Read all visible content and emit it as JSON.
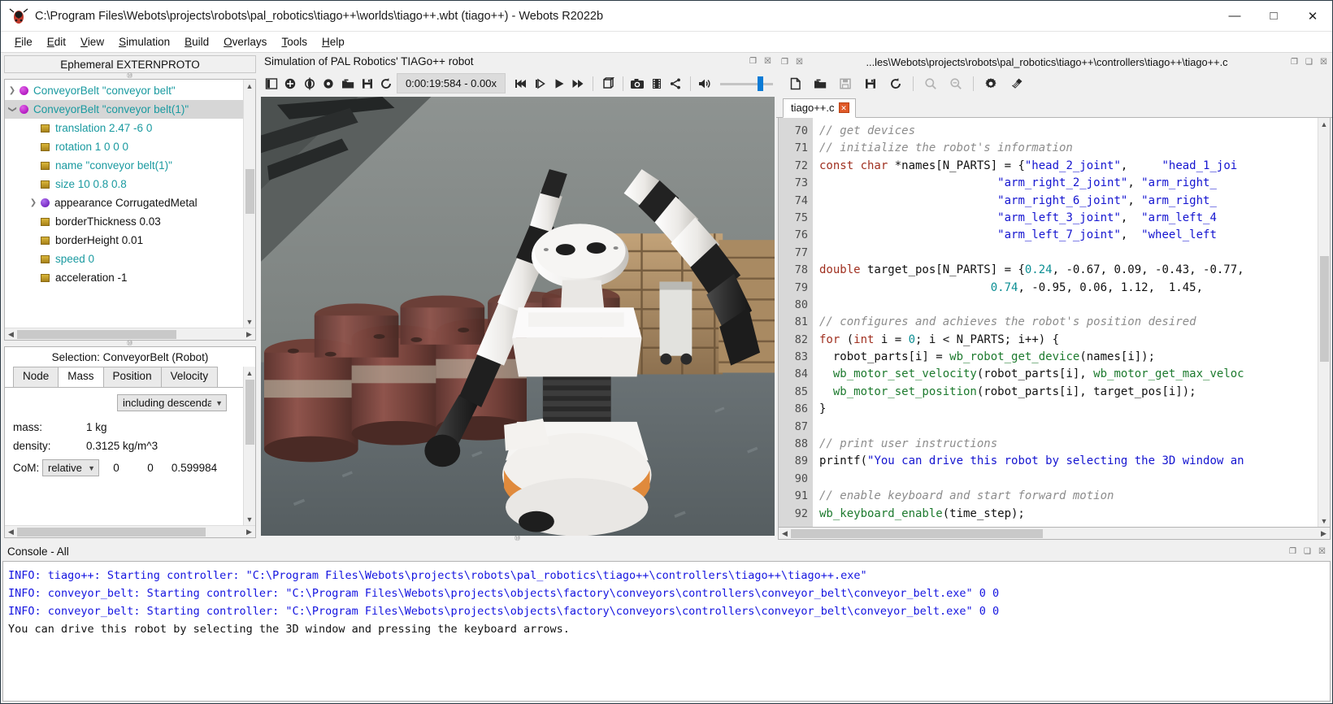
{
  "window": {
    "title": "C:\\Program Files\\Webots\\projects\\robots\\pal_robotics\\tiago++\\worlds\\tiago++.wbt (tiago++) - Webots R2022b",
    "minimize_label": "—",
    "maximize_label": "□",
    "close_label": "✕"
  },
  "menubar": [
    {
      "label": "File",
      "mnemonic": "F"
    },
    {
      "label": "Edit",
      "mnemonic": "E"
    },
    {
      "label": "View",
      "mnemonic": "V"
    },
    {
      "label": "Simulation",
      "mnemonic": "S"
    },
    {
      "label": "Build",
      "mnemonic": "B"
    },
    {
      "label": "Overlays",
      "mnemonic": "O"
    },
    {
      "label": "Tools",
      "mnemonic": "T"
    },
    {
      "label": "Help",
      "mnemonic": "H"
    }
  ],
  "scene_tree": {
    "header": "Ephemeral EXTERNPROTO",
    "items": [
      {
        "label": "ConveyorBelt \"conveyor belt\"",
        "kind": "node",
        "arrow": "collapsed",
        "indent": 0,
        "selected": false,
        "color": "teal"
      },
      {
        "label": "ConveyorBelt \"conveyor belt(1)\"",
        "kind": "node",
        "arrow": "expanded",
        "indent": 0,
        "selected": true,
        "color": "teal"
      },
      {
        "label": "translation 2.47 -6 0",
        "kind": "field",
        "arrow": "none",
        "indent": 1,
        "selected": false,
        "color": "teal"
      },
      {
        "label": "rotation 1 0 0 0",
        "kind": "field",
        "arrow": "none",
        "indent": 1,
        "selected": false,
        "color": "teal"
      },
      {
        "label": "name \"conveyor belt(1)\"",
        "kind": "field",
        "arrow": "none",
        "indent": 1,
        "selected": false,
        "color": "teal"
      },
      {
        "label": "size 10 0.8 0.8",
        "kind": "field",
        "arrow": "none",
        "indent": 1,
        "selected": false,
        "color": "teal"
      },
      {
        "label": "appearance CorrugatedMetal",
        "kind": "nodeblue",
        "arrow": "collapsed",
        "indent": 1,
        "selected": false,
        "color": "black"
      },
      {
        "label": "borderThickness 0.03",
        "kind": "field",
        "arrow": "none",
        "indent": 1,
        "selected": false,
        "color": "black"
      },
      {
        "label": "borderHeight 0.01",
        "kind": "field",
        "arrow": "none",
        "indent": 1,
        "selected": false,
        "color": "black"
      },
      {
        "label": "speed 0",
        "kind": "field",
        "arrow": "none",
        "indent": 1,
        "selected": false,
        "color": "teal"
      },
      {
        "label": "acceleration -1",
        "kind": "field",
        "arrow": "none",
        "indent": 1,
        "selected": false,
        "color": "black"
      }
    ]
  },
  "selection": {
    "title": "Selection: ConveyorBelt (Robot)",
    "tabs": [
      {
        "label": "Node",
        "active": false
      },
      {
        "label": "Mass",
        "active": true
      },
      {
        "label": "Position",
        "active": false
      },
      {
        "label": "Velocity",
        "active": false
      }
    ],
    "scope_select": "including descenda",
    "mass_key": "mass:",
    "mass_value": "1 kg",
    "density_key": "density:",
    "density_value": "0.3125 kg/m^3",
    "com_key": "CoM:",
    "com_frame": "relative",
    "com_x": "0",
    "com_y": "0",
    "com_z": "0.599984"
  },
  "simulation": {
    "panel_title": "Simulation of PAL Robotics' TIAGo++ robot",
    "time": "0:00:19:584  -  0.00x",
    "toolbar_icons": [
      "sidebar-toggle-icon",
      "add-node-icon",
      "orientation-icon",
      "view-icon",
      "open-world-icon",
      "save-world-icon",
      "reload-world-icon"
    ],
    "playback_icons": [
      "rewind-icon",
      "step-icon",
      "play-icon",
      "fast-forward-icon"
    ],
    "extra_icons": [
      "render-icon",
      "camera-icon",
      "movie-icon",
      "share-icon",
      "sound-icon"
    ]
  },
  "editor": {
    "path": "...les\\Webots\\projects\\robots\\pal_robotics\\tiago++\\controllers\\tiago++\\tiago++.c",
    "toolbar_icons": [
      "new-file-icon",
      "open-file-icon",
      "save-file-icon",
      "save-all-icon",
      "reload-file-icon",
      "find-icon",
      "find-next-icon",
      "gear-icon",
      "clean-icon"
    ],
    "tab": {
      "label": "tiago++.c",
      "close_label": "✕"
    },
    "first_line_number": 70,
    "lines": [
      {
        "n": 70,
        "tokens": [
          [
            "cm",
            "// get devices"
          ]
        ]
      },
      {
        "n": 71,
        "tokens": [
          [
            "cm",
            "// initialize the robot's information"
          ]
        ]
      },
      {
        "n": 72,
        "tokens": [
          [
            "kw",
            "const char"
          ],
          [
            "",
            " *names[N_PARTS] = {"
          ],
          [
            "st",
            "\"head_2_joint\""
          ],
          [
            "",
            ",     "
          ],
          [
            "st",
            "\"head_1_joi"
          ]
        ]
      },
      {
        "n": 73,
        "tokens": [
          [
            "",
            "                          "
          ],
          [
            "st",
            "\"arm_right_2_joint\""
          ],
          [
            "",
            ", "
          ],
          [
            "st",
            "\"arm_right_"
          ]
        ]
      },
      {
        "n": 74,
        "tokens": [
          [
            "",
            "                          "
          ],
          [
            "st",
            "\"arm_right_6_joint\""
          ],
          [
            "",
            ", "
          ],
          [
            "st",
            "\"arm_right_"
          ]
        ]
      },
      {
        "n": 75,
        "tokens": [
          [
            "",
            "                          "
          ],
          [
            "st",
            "\"arm_left_3_joint\""
          ],
          [
            "",
            ",  "
          ],
          [
            "st",
            "\"arm_left_4"
          ]
        ]
      },
      {
        "n": 76,
        "tokens": [
          [
            "",
            "                          "
          ],
          [
            "st",
            "\"arm_left_7_joint\""
          ],
          [
            "",
            ",  "
          ],
          [
            "st",
            "\"wheel_left"
          ]
        ]
      },
      {
        "n": 77,
        "tokens": [
          [
            "",
            ""
          ]
        ]
      },
      {
        "n": 78,
        "tokens": [
          [
            "kw",
            "double"
          ],
          [
            "",
            " target_pos[N_PARTS] = {"
          ],
          [
            "nu",
            "0.24"
          ],
          [
            "",
            ", -0.67, 0.09, -0.43, -0.77,"
          ]
        ]
      },
      {
        "n": 79,
        "tokens": [
          [
            "",
            "                         "
          ],
          [
            "nu",
            "0.74"
          ],
          [
            "",
            ", -0.95, 0.06, 1.12,  1.45, "
          ]
        ]
      },
      {
        "n": 80,
        "tokens": [
          [
            "",
            ""
          ]
        ]
      },
      {
        "n": 81,
        "tokens": [
          [
            "cm",
            "// configures and achieves the robot's position desired"
          ]
        ]
      },
      {
        "n": 82,
        "tokens": [
          [
            "kw",
            "for"
          ],
          [
            "",
            " ("
          ],
          [
            "kw",
            "int"
          ],
          [
            "",
            " i = "
          ],
          [
            "nu",
            "0"
          ],
          [
            "",
            "; i < N_PARTS; i++) {"
          ]
        ]
      },
      {
        "n": 83,
        "tokens": [
          [
            "",
            "  robot_parts[i] = "
          ],
          [
            "fn",
            "wb_robot_get_device"
          ],
          [
            "",
            "(names[i]);"
          ]
        ]
      },
      {
        "n": 84,
        "tokens": [
          [
            "",
            "  "
          ],
          [
            "fn",
            "wb_motor_set_velocity"
          ],
          [
            "",
            "(robot_parts[i], "
          ],
          [
            "fn",
            "wb_motor_get_max_veloc"
          ]
        ]
      },
      {
        "n": 85,
        "tokens": [
          [
            "",
            "  "
          ],
          [
            "fn",
            "wb_motor_set_position"
          ],
          [
            "",
            "(robot_parts[i], target_pos[i]);"
          ]
        ]
      },
      {
        "n": 86,
        "tokens": [
          [
            "",
            "}"
          ]
        ]
      },
      {
        "n": 87,
        "tokens": [
          [
            "",
            ""
          ]
        ]
      },
      {
        "n": 88,
        "tokens": [
          [
            "cm",
            "// print user instructions"
          ]
        ]
      },
      {
        "n": 89,
        "tokens": [
          [
            "",
            "printf("
          ],
          [
            "st",
            "\"You can drive this robot by selecting the 3D window an"
          ]
        ]
      },
      {
        "n": 90,
        "tokens": [
          [
            "",
            ""
          ]
        ]
      },
      {
        "n": 91,
        "tokens": [
          [
            "cm",
            "// enable keyboard and start forward motion"
          ]
        ]
      },
      {
        "n": 92,
        "tokens": [
          [
            "fn",
            "wb_keyboard_enable"
          ],
          [
            "",
            "(time_step);"
          ]
        ]
      }
    ]
  },
  "console": {
    "title": "Console - All",
    "lines": [
      {
        "text": "INFO: tiago++: Starting controller: \"C:\\Program Files\\Webots\\projects\\robots\\pal_robotics\\tiago++\\controllers\\tiago++\\tiago++.exe\"",
        "style": "info"
      },
      {
        "text": "INFO: conveyor_belt: Starting controller: \"C:\\Program Files\\Webots\\projects\\objects\\factory\\conveyors\\controllers\\conveyor_belt\\conveyor_belt.exe\" 0 0",
        "style": "info"
      },
      {
        "text": "INFO: conveyor_belt: Starting controller: \"C:\\Program Files\\Webots\\projects\\objects\\factory\\conveyors\\controllers\\conveyor_belt\\conveyor_belt.exe\" 0 0",
        "style": "info"
      },
      {
        "text": "You can drive this robot by selecting the 3D window and pressing the keyboard arrows.",
        "style": "plain"
      }
    ]
  },
  "colors": {
    "accent_blue": "#0a7bd6",
    "tree_teal": "#1a9aa0",
    "console_info": "#1414e0",
    "tab_close_red": "#e05a28"
  }
}
